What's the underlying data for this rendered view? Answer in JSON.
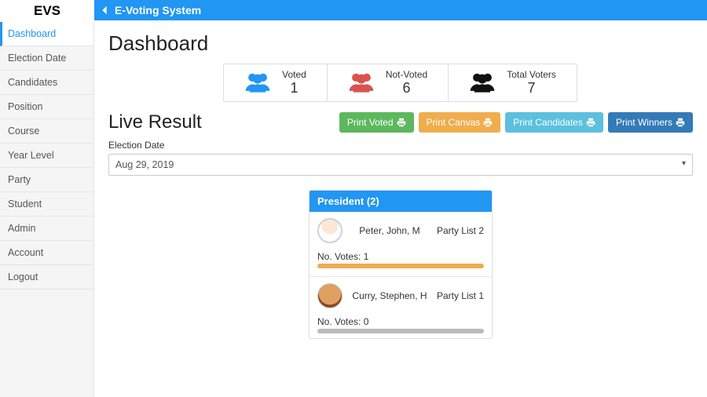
{
  "brand": "EVS",
  "header": {
    "title": "E-Voting System"
  },
  "sidebar": {
    "items": [
      {
        "label": "Dashboard",
        "active": true
      },
      {
        "label": "Election Date"
      },
      {
        "label": "Candidates"
      },
      {
        "label": "Position"
      },
      {
        "label": "Course"
      },
      {
        "label": "Year Level"
      },
      {
        "label": "Party"
      },
      {
        "label": "Student"
      },
      {
        "label": "Admin"
      },
      {
        "label": "Account"
      },
      {
        "label": "Logout"
      }
    ]
  },
  "page": {
    "title": "Dashboard"
  },
  "stats": {
    "voted": {
      "label": "Voted",
      "value": "1",
      "color": "#2196f3"
    },
    "not_voted": {
      "label": "Not-Voted",
      "value": "6",
      "color": "#d9534f"
    },
    "total_voters": {
      "label": "Total Voters",
      "value": "7",
      "color": "#111111"
    }
  },
  "live": {
    "title": "Live Result",
    "buttons": {
      "print_voted": "Print Voted",
      "print_canvas": "Print Canvas",
      "print_candidates": "Print Candidates",
      "print_winners": "Print Winners"
    },
    "election_date_label": "Election Date",
    "election_date_value": "Aug 29, 2019"
  },
  "position_card": {
    "heading": "President (2)",
    "candidates": [
      {
        "name": "Peter, John, M",
        "party": "Party List 2",
        "votes_label": "No. Votes: 1",
        "votes": 1,
        "bar_full": true
      },
      {
        "name": "Curry, Stephen, H",
        "party": "Party List 1",
        "votes_label": "No. Votes: 0",
        "votes": 0,
        "bar_full": false
      }
    ]
  }
}
